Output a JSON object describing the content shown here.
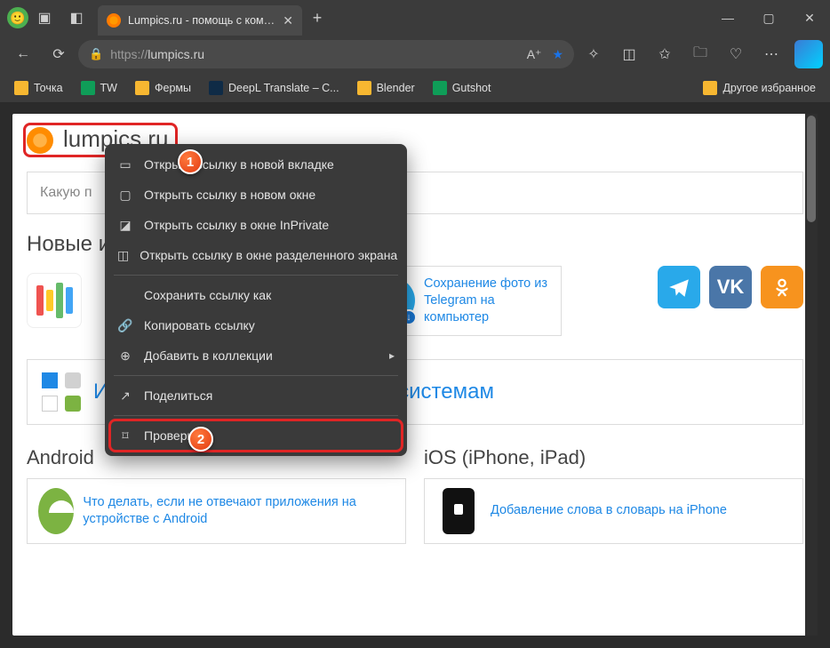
{
  "titlebar": {
    "tab_title": "Lumpics.ru - помощь с компьюте",
    "newtab": "+"
  },
  "toolbar": {
    "url_scheme": "https://",
    "url_host": "lumpics.ru",
    "aa": "A⁺"
  },
  "bookmarks": {
    "items": [
      {
        "label": "Точка"
      },
      {
        "label": "TW"
      },
      {
        "label": "Фермы"
      },
      {
        "label": "DeepL Translate – C..."
      },
      {
        "label": "Blender"
      },
      {
        "label": "Gutshot"
      }
    ],
    "overflow": "Другое избранное"
  },
  "site": {
    "title": "lumpics.ru",
    "search_placeholder": "Какую п",
    "section_new": "Новые и",
    "card_tg_text": "Сохранение фото из Telegram на компьютер",
    "os_heading": "Инструкции по операционным системам",
    "android_h": "Android",
    "android_text": "Что делать, если не отвечают приложения на устройстве с Android",
    "ios_h": "iOS (iPhone, iPad)",
    "ios_text": "Добавление слова в словарь на iPhone",
    "vk": "VK"
  },
  "ctx": {
    "items": [
      "Открыть ссылку в новой вкладке",
      "Открыть ссылку в новом окне",
      "Открыть ссылку в окне InPrivate",
      "Открыть ссылку в окне разделенного экрана",
      "Сохранить ссылку как",
      "Копировать ссылку",
      "Добавить в коллекции",
      "Поделиться",
      "Проверить"
    ]
  },
  "ann": {
    "b1": "1",
    "b2": "2"
  }
}
